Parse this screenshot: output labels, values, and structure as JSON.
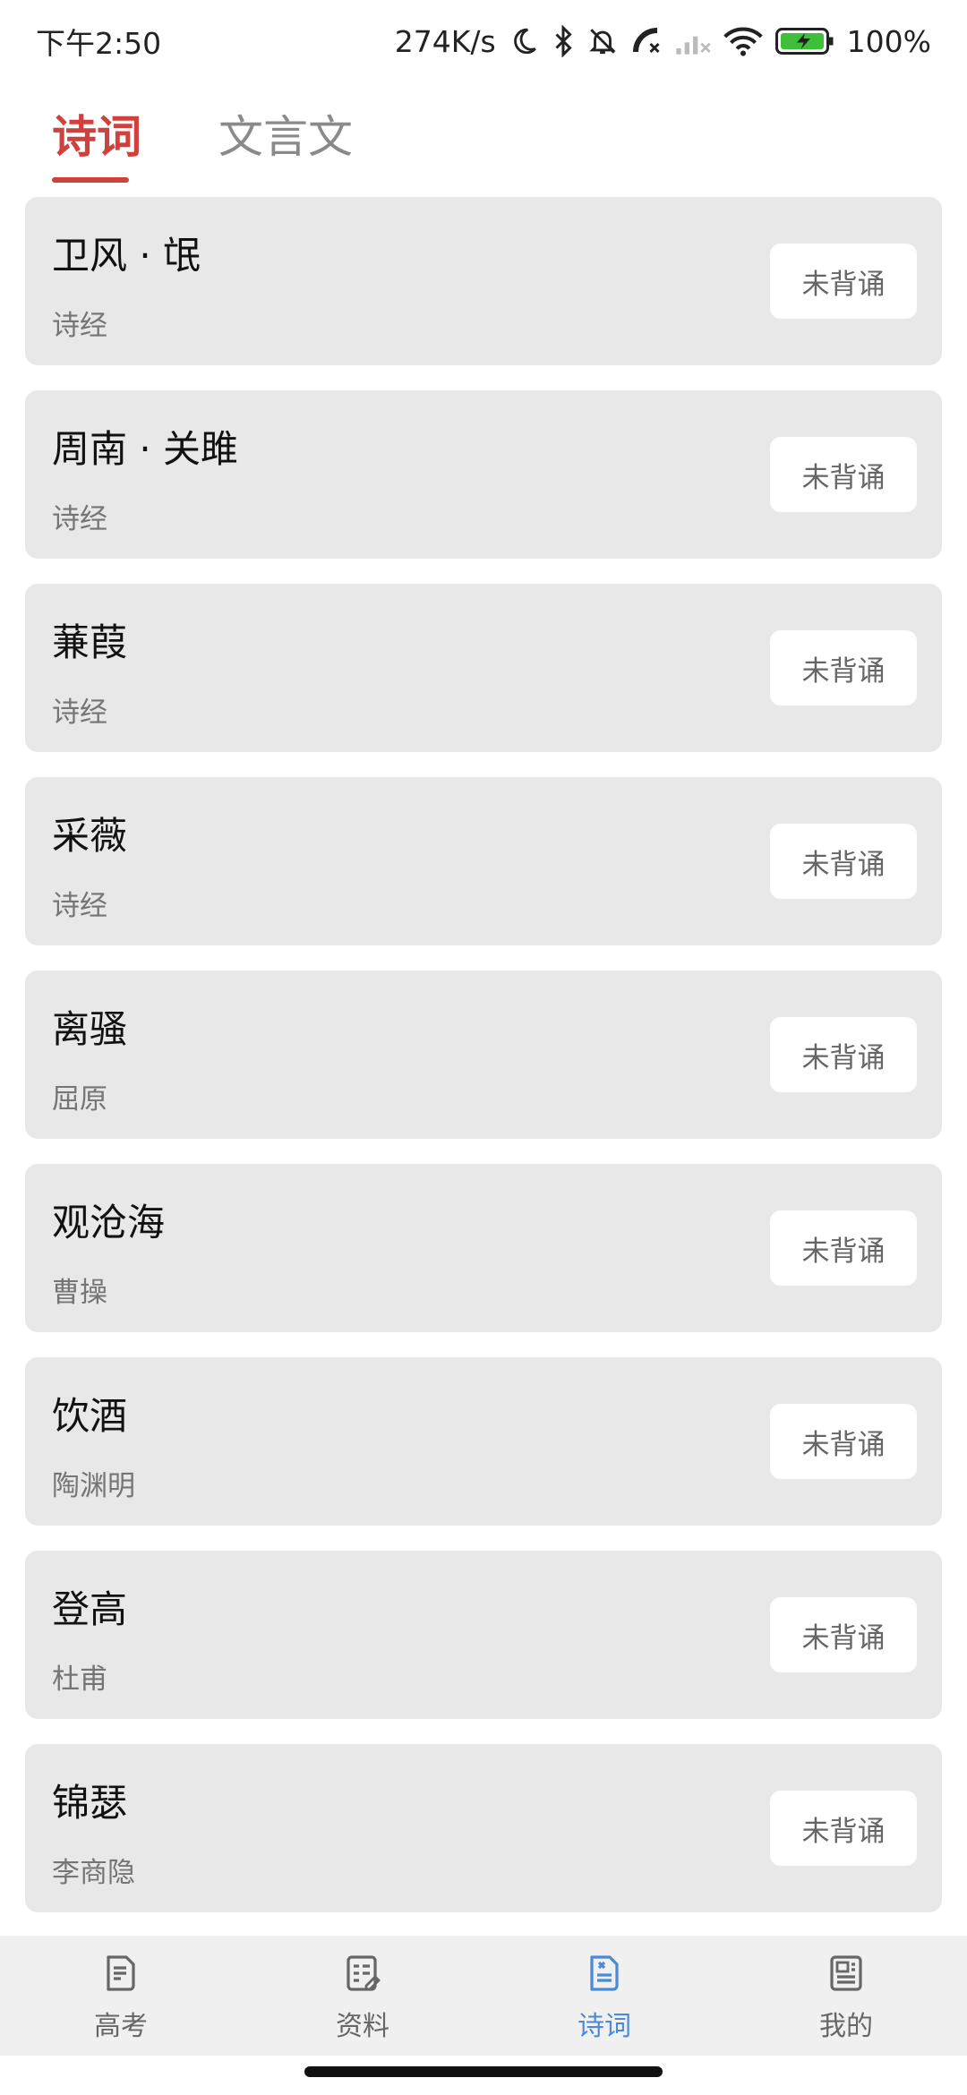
{
  "status_bar": {
    "time": "下午2:50",
    "net_speed": "274K/s",
    "battery": "100%",
    "icons": [
      "moon-icon",
      "bluetooth-icon",
      "bell-off-icon",
      "call-off-icon",
      "signal-icon",
      "wifi-icon",
      "battery-icon"
    ]
  },
  "tabs": [
    {
      "label": "诗词",
      "active": true
    },
    {
      "label": "文言文",
      "active": false
    }
  ],
  "poems": [
    {
      "title": "卫风 · 氓",
      "author": "诗经",
      "status": "未背诵"
    },
    {
      "title": "周南 · 关雎",
      "author": "诗经",
      "status": "未背诵"
    },
    {
      "title": "蒹葭",
      "author": "诗经",
      "status": "未背诵"
    },
    {
      "title": "采薇",
      "author": "诗经",
      "status": "未背诵"
    },
    {
      "title": "离骚",
      "author": "屈原",
      "status": "未背诵"
    },
    {
      "title": "观沧海",
      "author": "曹操",
      "status": "未背诵"
    },
    {
      "title": "饮酒",
      "author": "陶渊明",
      "status": "未背诵"
    },
    {
      "title": "登高",
      "author": "杜甫",
      "status": "未背诵"
    },
    {
      "title": "锦瑟",
      "author": "李商隐",
      "status": "未背诵"
    }
  ],
  "bottom_nav": [
    {
      "label": "高考",
      "icon": "gaokao-doc-icon",
      "active": false
    },
    {
      "label": "资料",
      "icon": "materials-icon",
      "active": false
    },
    {
      "label": "诗词",
      "icon": "poetry-doc-icon",
      "active": true
    },
    {
      "label": "我的",
      "icon": "profile-icon",
      "active": false
    }
  ],
  "colors": {
    "accent_red": "#d0403d",
    "active_blue": "#4a8ad6",
    "card_bg": "#e8e8e8"
  }
}
